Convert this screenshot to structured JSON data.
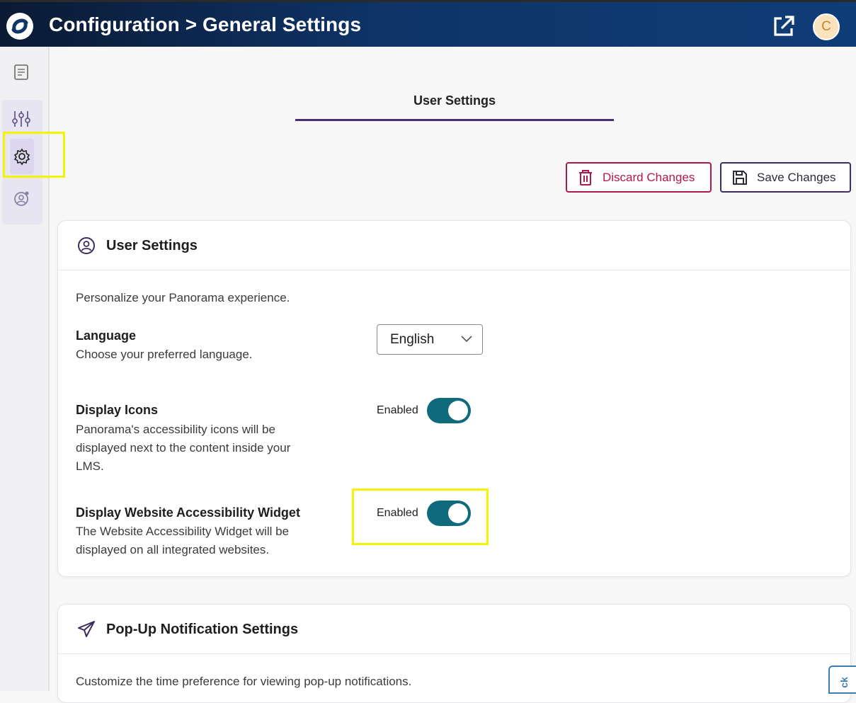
{
  "header": {
    "title": "Configuration > General Settings",
    "avatar_initial": "C"
  },
  "tabs": {
    "active_label": "User Settings"
  },
  "actions": {
    "discard_label": "Discard Changes",
    "save_label": "Save Changes"
  },
  "user_settings": {
    "title": "User Settings",
    "description": "Personalize your Panorama experience.",
    "language": {
      "title": "Language",
      "description": "Choose your preferred language.",
      "selected": "English"
    },
    "display_icons": {
      "title": "Display Icons",
      "description_lines": [
        "Panorama's accessibility icons will be",
        "displayed next to the content inside your",
        "LMS."
      ],
      "toggle_label": "Enabled",
      "enabled": true
    },
    "display_widget": {
      "title": "Display Website Accessibility Widget",
      "description_lines": [
        "The Website Accessibility Widget will be",
        "displayed on all integrated websites."
      ],
      "toggle_label": "Enabled",
      "enabled": true
    }
  },
  "popup_settings": {
    "title": "Pop-Up Notification Settings",
    "description": "Customize the time preference for viewing pop-up notifications."
  },
  "feedback_tab": {
    "label": "ck"
  },
  "colors": {
    "header_start": "#0a1a33",
    "header_end": "#0f3d77",
    "toggle_on": "#0f6a7c",
    "discard": "#b0174a",
    "accent": "#4a2e6e",
    "highlight": "#f3f500"
  }
}
